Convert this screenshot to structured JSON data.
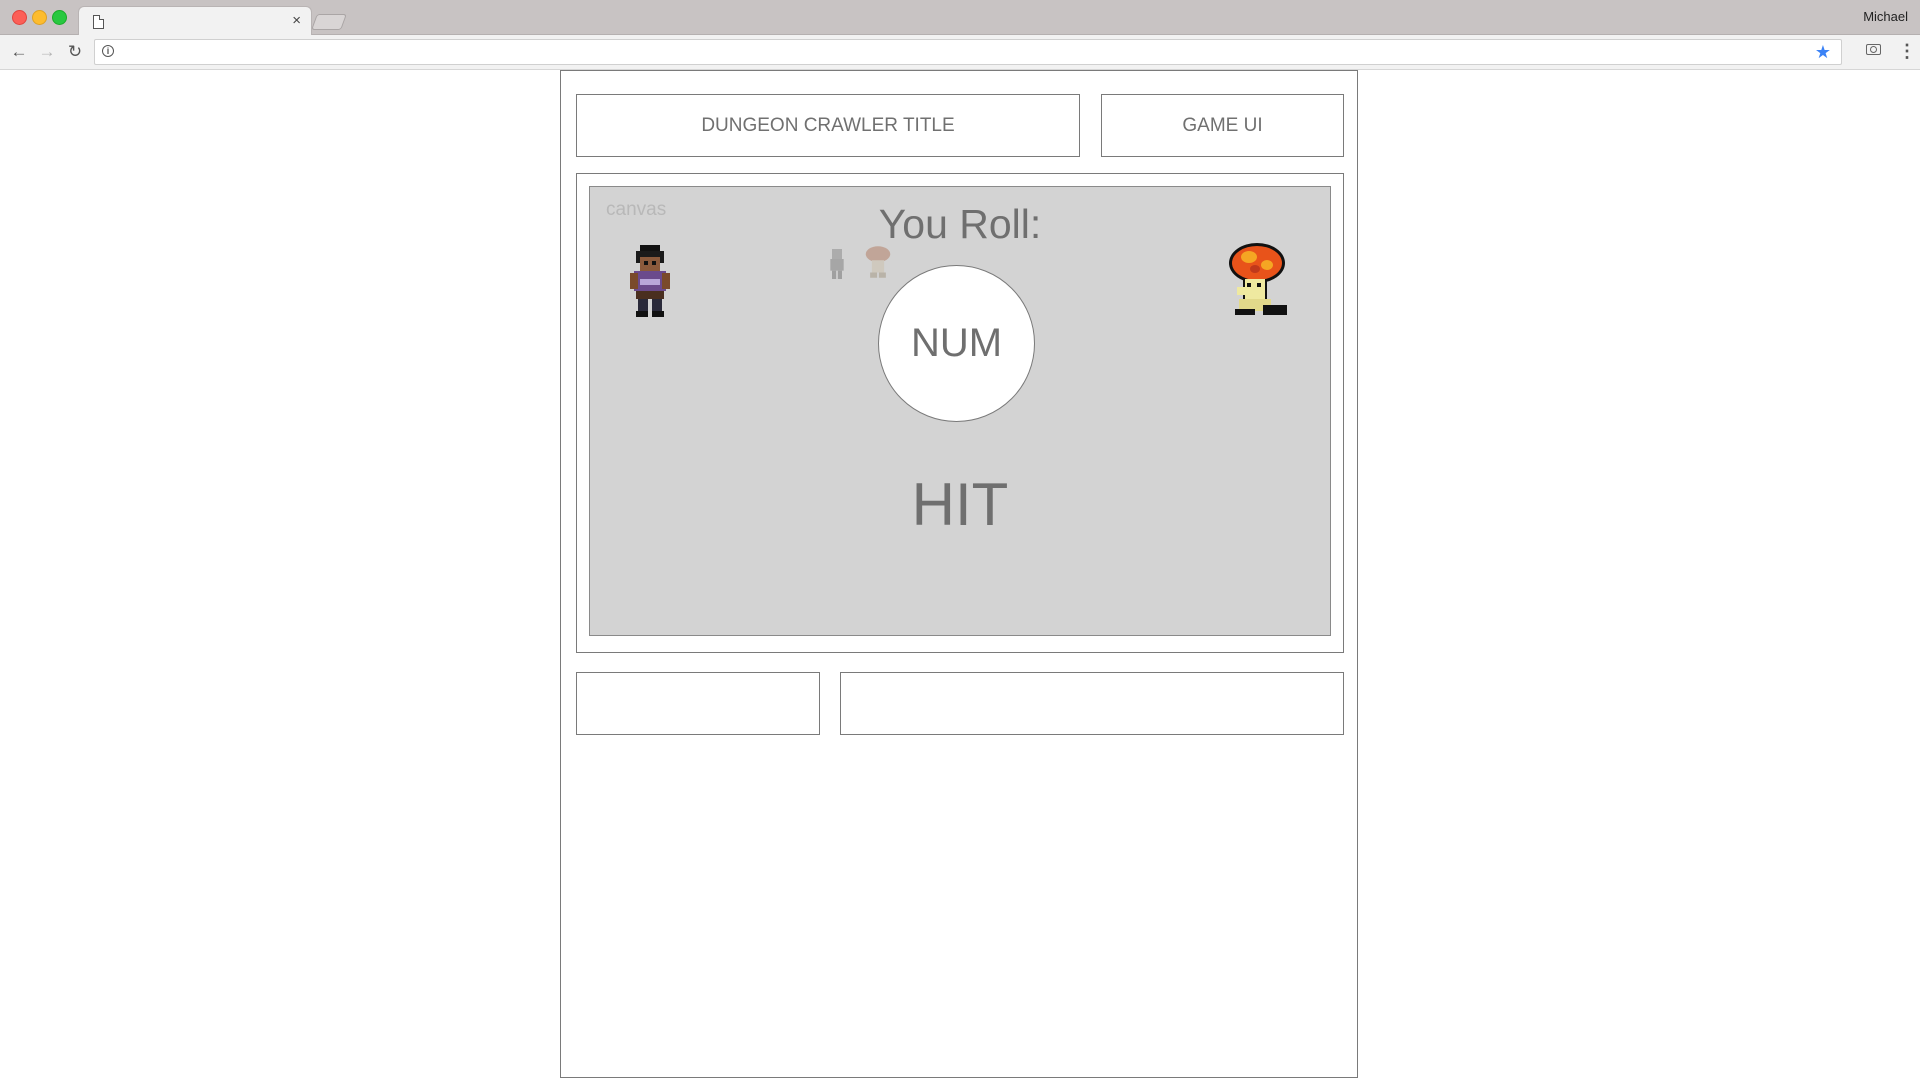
{
  "browser": {
    "profile_name": "Michael",
    "tab_close_glyph": "×",
    "icons": [
      "back-arrow-icon",
      "forward-arrow-icon",
      "reload-icon",
      "info-icon",
      "star-icon",
      "camera-icon",
      "menu-icon"
    ]
  },
  "header": {
    "title": "DUNGEON CRAWLER TITLE",
    "game_ui": "GAME UI"
  },
  "stage": {
    "canvas_label": "canvas",
    "roll_label": "You Roll:",
    "roll_value": "NUM",
    "result": "HIT"
  },
  "colors": {
    "canvas_bg": "#d3d3d3",
    "text_gray": "#6f6f6f",
    "star_blue": "#3b82f6"
  }
}
